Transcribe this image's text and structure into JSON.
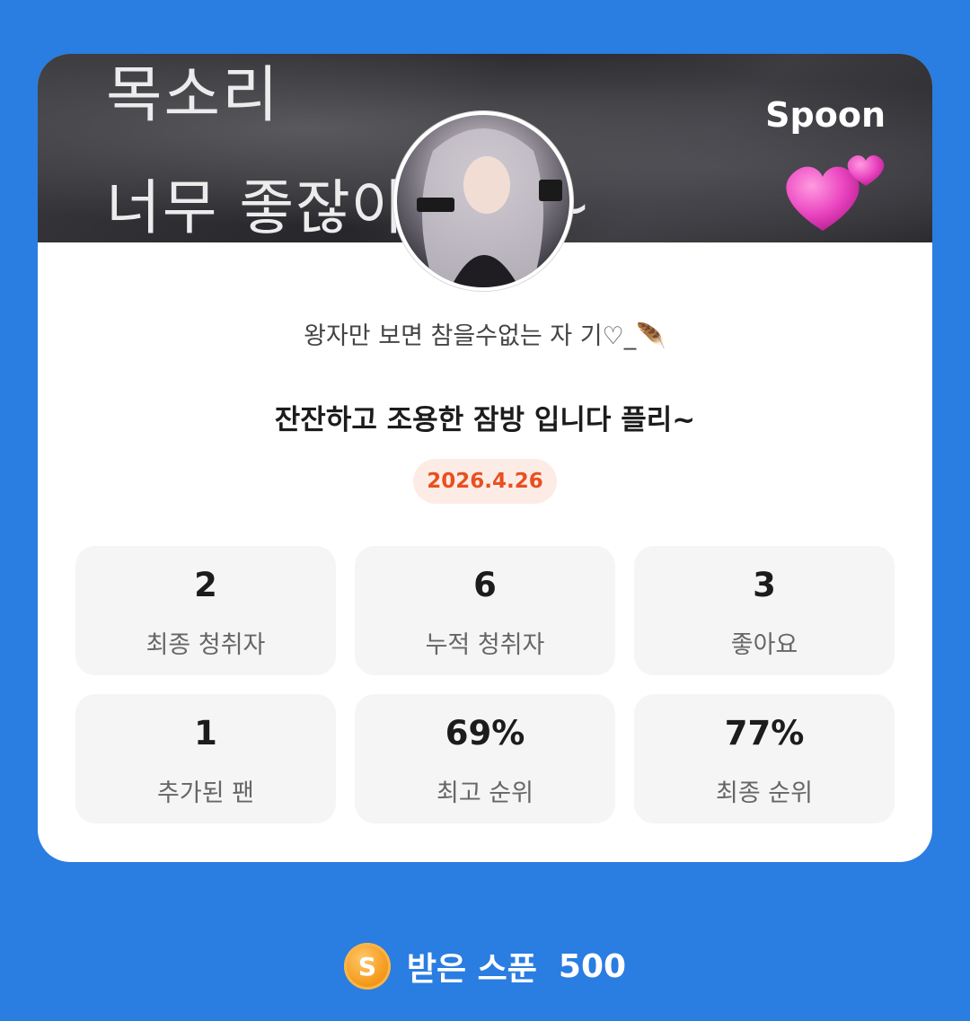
{
  "banner": {
    "line1": "목소리",
    "line2": "너무 좋잖아 쟈기~",
    "brand": "Spoon",
    "heart_icon": "two-hearts-icon"
  },
  "profile": {
    "nickname": "왕자만 보면 참을수없는 자 기♡_🪶",
    "avatar_icon": "profile-avatar"
  },
  "live": {
    "title": "잔잔하고 조용한 잠방 입니다 플리~",
    "date": "2026.4.26"
  },
  "stats": [
    {
      "value": "2",
      "label": "최종 청취자"
    },
    {
      "value": "6",
      "label": "누적 청취자"
    },
    {
      "value": "3",
      "label": "좋아요"
    },
    {
      "value": "1",
      "label": "추가된 팬"
    },
    {
      "value": "69%",
      "label": "최고 순위"
    },
    {
      "value": "77%",
      "label": "최종 순위"
    }
  ],
  "footer": {
    "coin_symbol": "S",
    "label": "받은 스푼",
    "value": "500"
  },
  "colors": {
    "background": "#2a7de1",
    "date_accent": "#e8501f",
    "date_bg": "#fdece6",
    "coin": "#f59a1c"
  }
}
